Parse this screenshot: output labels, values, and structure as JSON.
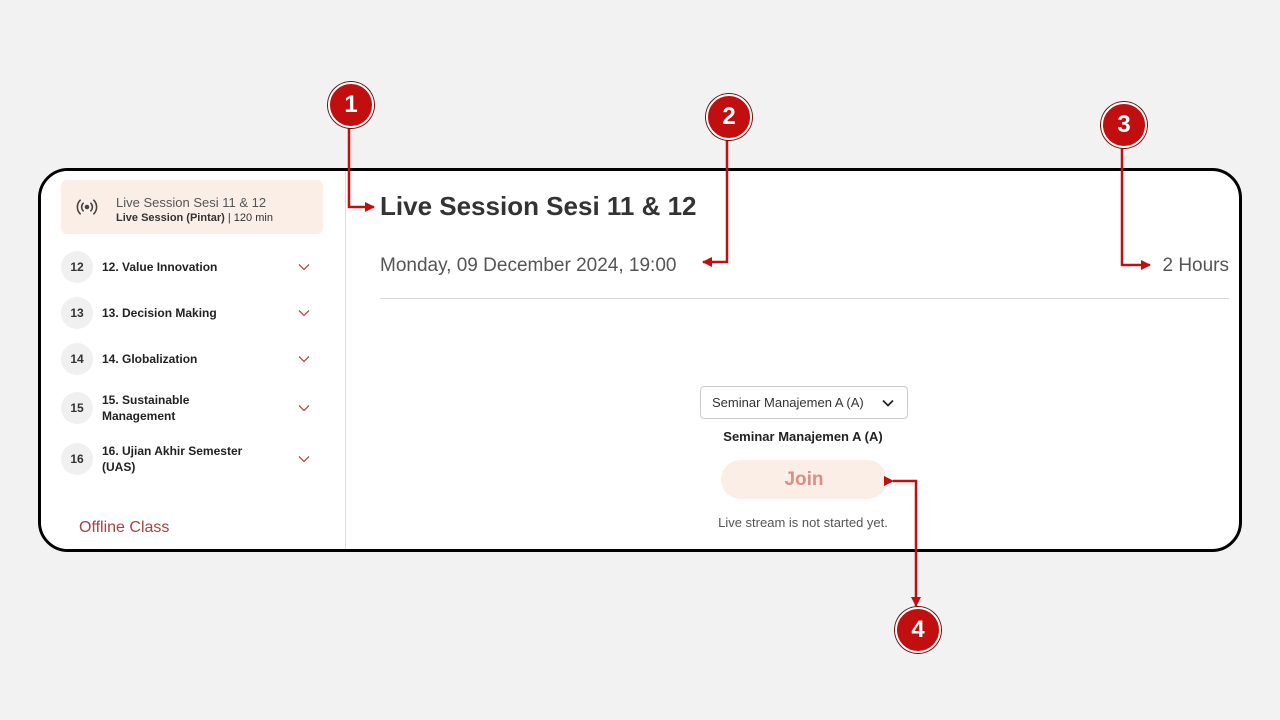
{
  "sidebar": {
    "active_item": {
      "title": "Live Session Sesi 11 & 12",
      "type": "Live Session (Pintar)",
      "separator": " | ",
      "duration": "120 min",
      "icon": "live-broadcast-icon"
    },
    "meetings": [
      {
        "number": "12",
        "label": "12. Value Innovation"
      },
      {
        "number": "13",
        "label": "13. Decision Making"
      },
      {
        "number": "14",
        "label": "14. Globalization"
      },
      {
        "number": "15",
        "label": "15. Sustainable Management"
      },
      {
        "number": "16",
        "label": "16. Ujian Akhir Semester (UAS)"
      }
    ],
    "offline_class": "Offline Class"
  },
  "main": {
    "title": "Live Session Sesi 11 & 12",
    "datetime": "Monday, 09 December 2024, 19:00",
    "duration": "2 Hours",
    "class_select": {
      "selected": "Seminar Manajemen A (A)"
    },
    "class_label": "Seminar Manajemen A (A)",
    "join_label": "Join",
    "status": "Live stream is not started yet."
  },
  "annotations": {
    "badges": [
      "1",
      "2",
      "3",
      "4"
    ],
    "color": "#c10e0e"
  },
  "colors": {
    "accent": "#a8433b",
    "active_bg": "#fbeee6",
    "join_text": "#d88f86",
    "background": "#f2f2f2"
  }
}
